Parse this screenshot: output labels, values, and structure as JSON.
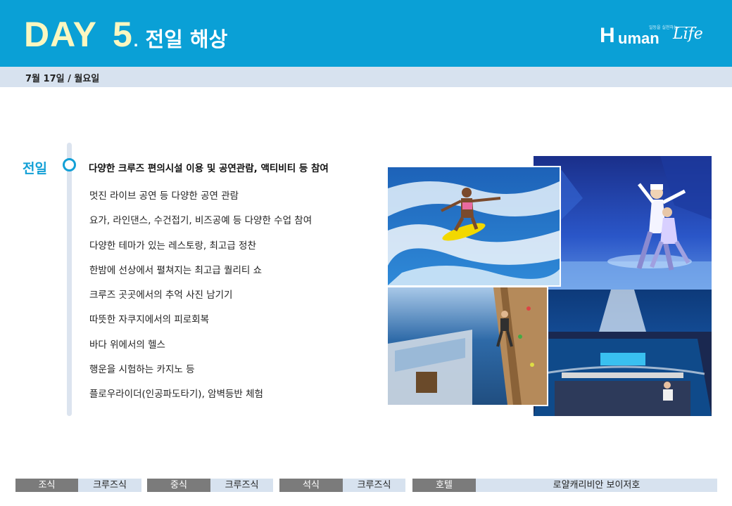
{
  "header": {
    "day_word": "DAY",
    "day_number": "5",
    "day_dot": ".",
    "day_subtitle": "전일 해상",
    "logo": {
      "mark": "H",
      "wordmark": "uman",
      "script": "Life",
      "tagline": "일등을 실천하는"
    }
  },
  "date": "7월 17일 / 월요일",
  "section": {
    "label": "전일",
    "heading": "다양한 크루즈 편의시설 이용 및 공연관람, 액티비티 등 참여",
    "items": [
      "멋진 라이브 공연 등 다양한 공연 관람",
      "요가, 라인댄스, 수건접기, 비즈공예 등 다양한 수업 참여",
      "다양한 테마가 있는 레스토랑, 최고급 정찬",
      "한밤에 선상에서 펼쳐지는 최고급 퀄리티 쇼",
      "크루즈 곳곳에서의 추억 사진 남기기",
      "따뜻한 자쿠지에서의 피로회복",
      "바다 위에서의 헬스",
      "행운을 시험하는 카지노 등",
      "플로우라이더(인공파도타기), 암벽등반 체험"
    ]
  },
  "meals": {
    "breakfast_label": "조식",
    "breakfast_value": "크루즈식",
    "lunch_label": "중식",
    "lunch_value": "크루즈식",
    "dinner_label": "석식",
    "dinner_value": "크루즈식",
    "hotel_label": "호텔",
    "hotel_value": "로얄캐리비안 보이저호"
  },
  "colors": {
    "header_bg": "#0aa0d6",
    "day_text": "#fbf7c0",
    "accent": "#13a0d6",
    "band_bg": "#d7e2ef",
    "meal_label_bg": "#7b7b7b"
  }
}
